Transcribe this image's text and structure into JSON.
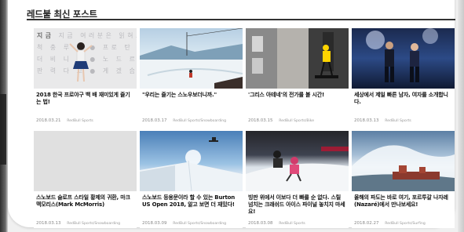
{
  "section": {
    "title": "레드불 최신 포스트"
  },
  "posts": [
    {
      "title": "2018 한국 프로야구 백 배 재미있게 즐기는 법!",
      "date": "2018.03.21",
      "category": "RedBull Sports",
      "thumb_grid_rows": [
        "지금 여러분은 읽혀보세",
        "척 충 루 판 ● 프로 탄 외",
        "더 비 니 배 ● 노 드 르 스",
        "판 력 다 고 ● 게 겠 습 니 다"
      ],
      "thumb_highlight": "지금"
    },
    {
      "title": "\"우리는 즐기는 스노우보더니까.\"",
      "date": "2018.03.17",
      "category": "RedBull Sports/Snowboarding"
    },
    {
      "title": "'그리스 아테네'의 전가를 볼 시간!",
      "date": "2018.03.15",
      "category": "RedBull Sports/Bike"
    },
    {
      "title": "세상에서 제일 빠른 남자, 여자를 소개합니다.",
      "date": "2018.03.13",
      "category": "RedBull Sports"
    },
    {
      "title": "스노보드 슬로프 스타일 황제의 귀환, 마크 맥모리스(Mark McMorris)",
      "date": "2018.03.13",
      "category": "RedBull Sports/Snowboarding"
    },
    {
      "title": "스노보드 등용문이라 할 수 있는 Burton US Open 2018, 알고 보면 더 재밌다!",
      "date": "2018.03.09",
      "category": "RedBull Sports/Snowboarding"
    },
    {
      "title": "빙판 위에서 이보다 더 빠를 순 없다. 스릴 넘치는 크래쉬드 아이스 파이널 놓치지 마세요!",
      "date": "2018.03.08",
      "category": "RedBull Sports"
    },
    {
      "title": "올해의 파도는 바로 여기, 포르투갈 나자레(Nazaré)에서 만나보세요!",
      "date": "2018.02.27",
      "category": "RedBull Sports/Surfing"
    }
  ]
}
